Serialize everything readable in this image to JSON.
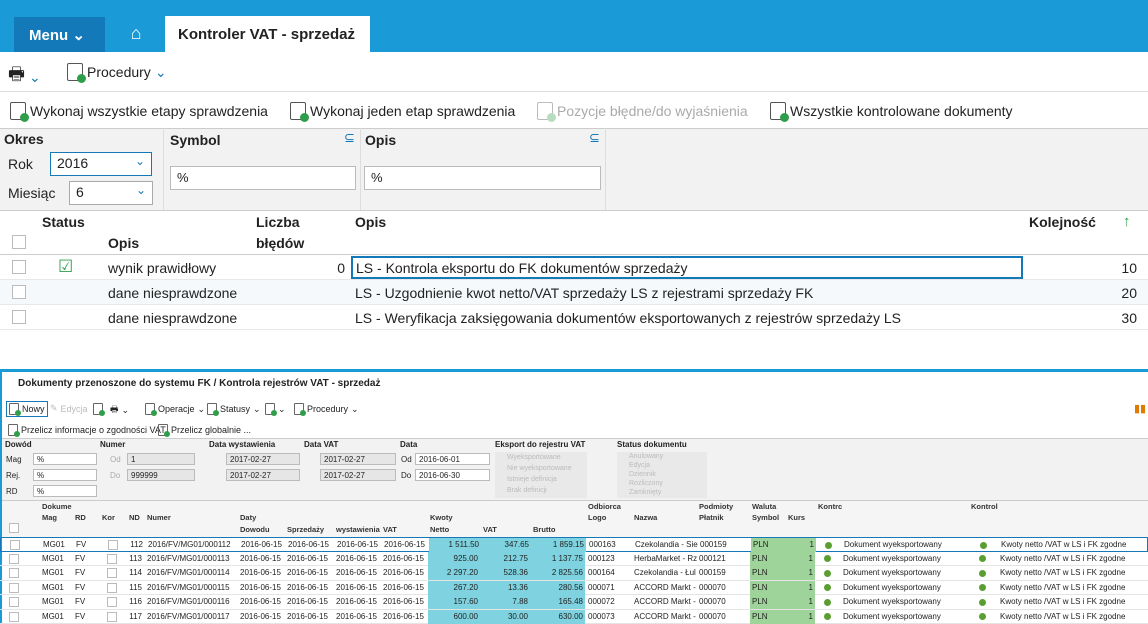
{
  "header": {
    "menu_label": "Menu",
    "tab_title": "Kontroler VAT - sprzedaż"
  },
  "toolbar": {
    "procedury": "Procedury"
  },
  "actions": [
    "Wykonaj wszystkie etapy sprawdzenia",
    "Wykonaj jeden etap sprawdzenia",
    "Pozycje błędne/do wyjaśnienia",
    "Wszystkie kontrolowane dokumenty"
  ],
  "filters": {
    "okres": "Okres",
    "rok_label": "Rok",
    "rok_value": "2016",
    "miesiac_label": "Miesiąc",
    "miesiac_value": "6",
    "symbol_label": "Symbol",
    "symbol_value": "%",
    "opis_label": "Opis",
    "opis_value": "%"
  },
  "grid": {
    "headers": {
      "status": "Status",
      "status_opis": "Opis",
      "liczba": "Liczba",
      "bledow": "błędów",
      "opis": "Opis",
      "kolejnosc": "Kolejność"
    },
    "rows": [
      {
        "status": "wynik prawidłowy",
        "errors": "0",
        "opis": "LS - Kontrola eksportu do FK dokumentów sprzedaży",
        "order": "10",
        "icon": true
      },
      {
        "status": "dane niesprawdzone",
        "errors": "",
        "opis": "LS - Uzgodnienie kwot netto/VAT sprzedaży LS  z rejestrami sprzedaży FK",
        "order": "20",
        "icon": false
      },
      {
        "status": "dane niesprawdzone",
        "errors": "",
        "opis": "LS - Weryfikacja zaksięgowania dokumentów eksportowanych z rejestrów sprzedaży LS",
        "order": "30",
        "icon": false
      }
    ]
  },
  "panel": {
    "title": "Dokumenty przenoszone do systemu FK / Kontrola rejestrów VAT - sprzedaż",
    "toolbar": {
      "nowy": "Nowy",
      "edycja": "Edycja",
      "operacje": "Operacje",
      "statusy": "Statusy",
      "procedury": "Procedury"
    },
    "actions": [
      "Przelicz informacje o zgodności VAT",
      "Przelicz globalnie ..."
    ],
    "filters": {
      "dowod": "Dowód",
      "mag": "Mag",
      "rej": "Rej.",
      "rd": "RD",
      "pct": "%",
      "numer": "Numer",
      "od": "Od",
      "do": "Do",
      "num_od": "1",
      "num_do": "999999",
      "data_wyst": "Data wystawienia",
      "data_vat": "Data VAT",
      "data": "Data",
      "wyst_od": "2017-02-27",
      "wyst_do": "2017-02-27",
      "vat_od": "2017-02-27",
      "vat_do": "2017-02-27",
      "data_od": "2016-06-01",
      "data_do": "2016-06-30",
      "eksport": "Eksport do rejestru VAT",
      "eksport_opts": [
        "Wyeksportowane",
        "Nie wyeksportowane",
        "Istnieje definicja",
        "Brak definicji"
      ],
      "status_dok": "Status dokumentu",
      "status_opts": [
        "Anulowany",
        "Edycja",
        "Dziennik",
        "Rozliczony",
        "Zamknięty"
      ]
    },
    "headers": {
      "dokume": "Dokume",
      "mag": "Mag",
      "rd": "RD",
      "kor": "Kor",
      "nd": "ND",
      "numer": "Numer",
      "daty": "Daty",
      "dowodu": "Dowodu",
      "sprzedazy": "Sprzedaży",
      "wystawienia": "wystawienia",
      "vat": "VAT",
      "kwoty": "Kwoty",
      "netto": "Netto",
      "kvat": "VAT",
      "brutto": "Brutto",
      "odbiorca": "Odbiorca",
      "logo": "Logo",
      "nazwa": "Nazwa",
      "podmioty": "Podmioty",
      "platnik": "Płatnik",
      "waluta": "Waluta",
      "symbol": "Symbol",
      "kurs": "Kurs",
      "kontr1": "Kontrc",
      "kontr2": "Kontrol"
    },
    "rows": [
      [
        "MG01",
        "FV",
        "112",
        "2016/FV/MG01/000112",
        "2016-06-15",
        "2016-06-15",
        "2016-06-15",
        "2016-06-15",
        "1 511.50",
        "347.65",
        "1 859.15",
        "000163",
        "Czekolandia - Sie",
        "000159",
        "PLN",
        "1",
        "Dokument wyeksportowany",
        "Kwoty netto /VAT w LS i FK zgodne"
      ],
      [
        "MG01",
        "FV",
        "113",
        "2016/FV/MG01/000113",
        "2016-06-15",
        "2016-06-15",
        "2016-06-15",
        "2016-06-15",
        "925.00",
        "212.75",
        "1 137.75",
        "000123",
        "HerbaMarket - Rz",
        "000121",
        "PLN",
        "1",
        "Dokument wyeksportowany",
        "Kwoty netto /VAT w LS i FK zgodne"
      ],
      [
        "MG01",
        "FV",
        "114",
        "2016/FV/MG01/000114",
        "2016-06-15",
        "2016-06-15",
        "2016-06-15",
        "2016-06-15",
        "2 297.20",
        "528.36",
        "2 825.56",
        "000164",
        "Czekolandia - Łul",
        "000159",
        "PLN",
        "1",
        "Dokument wyeksportowany",
        "Kwoty netto /VAT w LS i FK zgodne"
      ],
      [
        "MG01",
        "FV",
        "115",
        "2016/FV/MG01/000115",
        "2016-06-15",
        "2016-06-15",
        "2016-06-15",
        "2016-06-15",
        "267.20",
        "13.36",
        "280.56",
        "000071",
        "ACCORD Markt -",
        "000070",
        "PLN",
        "1",
        "Dokument wyeksportowany",
        "Kwoty netto /VAT w LS i FK zgodne"
      ],
      [
        "MG01",
        "FV",
        "116",
        "2016/FV/MG01/000116",
        "2016-06-15",
        "2016-06-15",
        "2016-06-15",
        "2016-06-15",
        "157.60",
        "7.88",
        "165.48",
        "000072",
        "ACCORD Markt -",
        "000070",
        "PLN",
        "1",
        "Dokument wyeksportowany",
        "Kwoty netto /VAT w LS i FK zgodne"
      ],
      [
        "MG01",
        "FV",
        "117",
        "2016/FV/MG01/000117",
        "2016-06-15",
        "2016-06-15",
        "2016-06-15",
        "2016-06-15",
        "600.00",
        "30.00",
        "630.00",
        "000073",
        "ACCORD Markt -",
        "000070",
        "PLN",
        "1",
        "Dokument wyeksportowany",
        "Kwoty netto /VAT w LS i FK zgodne"
      ]
    ]
  },
  "colors": {
    "brand": "#1a9ad6",
    "menu": "#1479b8",
    "amounts": "#7fd3e0",
    "currency": "#9ed49a",
    "ok": "#5a9e32"
  }
}
